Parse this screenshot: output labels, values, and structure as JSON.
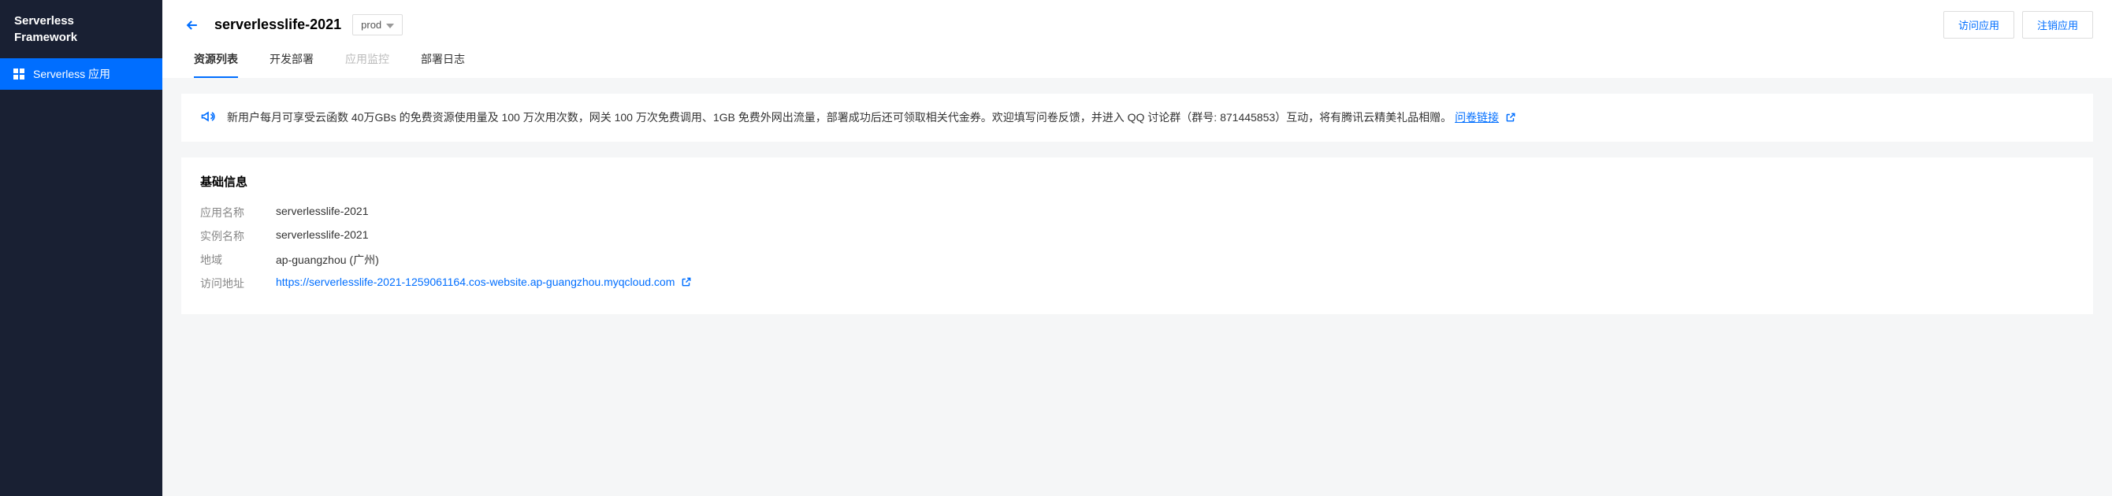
{
  "sidebar": {
    "logo_line1": "Serverless",
    "logo_line2": "Framework",
    "items": [
      {
        "label": "Serverless 应用"
      }
    ]
  },
  "header": {
    "app_title": "serverlesslife-2021",
    "env_label": "prod",
    "actions": {
      "visit": "访问应用",
      "delete": "注销应用"
    }
  },
  "tabs": [
    {
      "label": "资源列表",
      "active": true
    },
    {
      "label": "开发部署"
    },
    {
      "label": "应用监控",
      "disabled": true
    },
    {
      "label": "部署日志"
    }
  ],
  "notice": {
    "text_before_link": "新用户每月可享受云函数 40万GBs 的免费资源使用量及 100 万次用次数，网关 100 万次免费调用、1GB 免费外网出流量，部署成功后还可领取相关代金券。欢迎填写问卷反馈，并进入 QQ 讨论群（群号: 871445853）互动，将有腾讯云精美礼品相赠。",
    "link_text": "问卷链接"
  },
  "basic_info": {
    "title": "基础信息",
    "rows": {
      "app_name": {
        "label": "应用名称",
        "value": "serverlesslife-2021"
      },
      "instance_name": {
        "label": "实例名称",
        "value": "serverlesslife-2021"
      },
      "region": {
        "label": "地域",
        "value": "ap-guangzhou (广州)"
      },
      "url": {
        "label": "访问地址",
        "value": "https://serverlesslife-2021-1259061164.cos-website.ap-guangzhou.myqcloud.com"
      }
    }
  }
}
